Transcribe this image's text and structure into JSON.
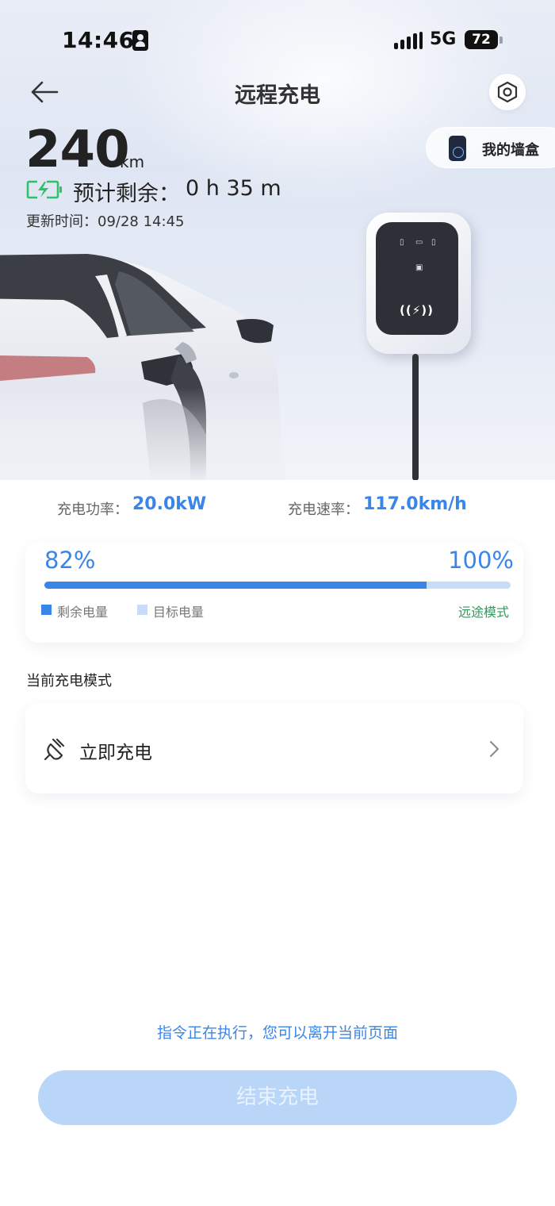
{
  "status_bar": {
    "time": "14:46",
    "network": "5G",
    "battery": "72"
  },
  "header": {
    "title": "远程充电"
  },
  "wallbox": {
    "label": "我的墙盒"
  },
  "range": {
    "value": "240",
    "unit": "km"
  },
  "remaining": {
    "label": "预计剩余：",
    "value": "0 h 35 m"
  },
  "update": {
    "text": "更新时间：09/28 14:45"
  },
  "charger_panel": {
    "nfc_label": "((⚡))"
  },
  "stats": {
    "power_label": "充电功率：",
    "power_value": "20.0kW",
    "speed_label": "充电速率：",
    "speed_value": "117.0km/h"
  },
  "soc": {
    "current": "82%",
    "target": "100%",
    "current_fraction": 0.82,
    "legend_remaining": "剩余电量",
    "legend_target": "目标电量",
    "mode": "远途模式"
  },
  "mode_section": {
    "title": "当前充电模式",
    "mode_label": "立即充电"
  },
  "footer": {
    "note": "指令正在执行，您可以离开当前页面",
    "end_button": "结束充电"
  },
  "colors": {
    "accent": "#3a86e8",
    "progress_track": "#c6dcf8",
    "mode_green": "#2e9a5c",
    "battery_green": "#2ec26a",
    "button_disabled": "#b9d6f8"
  },
  "icons": [
    "back-arrow-icon",
    "settings-hexagon-icon",
    "wallbox-icon",
    "battery-charging-icon",
    "plug-icon",
    "chevron-right-icon",
    "signal-icon",
    "person-icon"
  ]
}
